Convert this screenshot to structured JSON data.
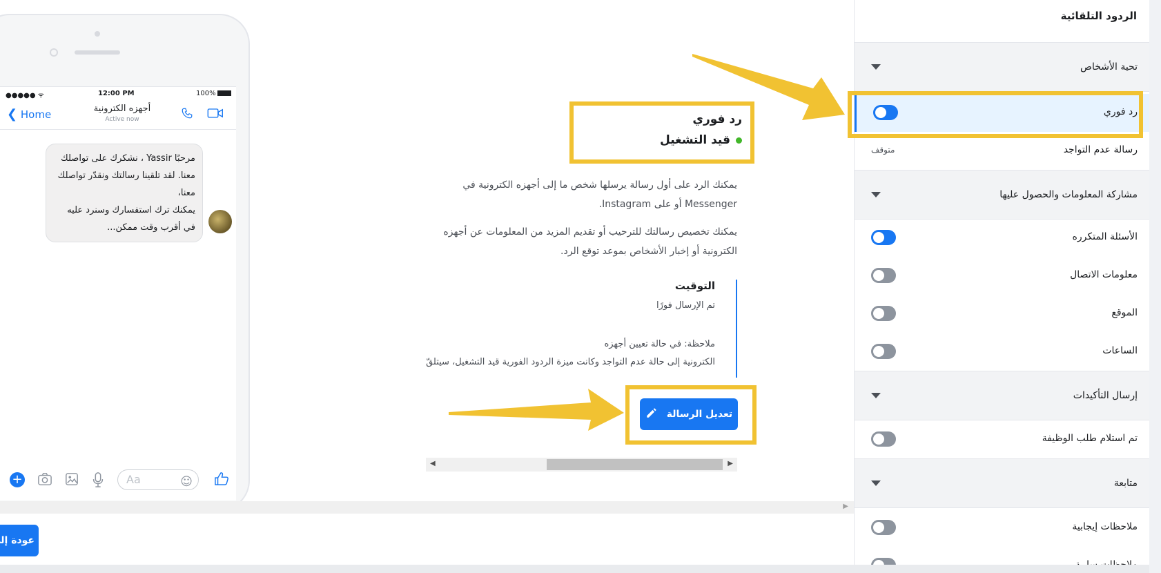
{
  "panel": {
    "title": "الردود التلقائية",
    "sections": [
      {
        "label": "تحية الأشخاص"
      },
      {
        "label": "مشاركة المعلومات والحصول عليها"
      },
      {
        "label": "إرسال التأكيدات"
      },
      {
        "label": "متابعة"
      }
    ],
    "rows": {
      "instant_reply": "رد فوري",
      "away_message": "رسالة عدم التواجد",
      "away_status": "متوقف",
      "faq": "الأسئلة المتكرره",
      "contact_info": "معلومات الاتصال",
      "location": "الموقع",
      "hours": "الساعات",
      "job_application": "تم استلام طلب الوظيفة",
      "positive_feedback": "ملاحظات إيجابية",
      "negative_feedback": "ملاحظات سلبية"
    }
  },
  "detail": {
    "title": "رد فوري",
    "status": "قيد التشغيل",
    "desc1": "يمكنك الرد على أول رسالة يرسلها شخص ما إلى أجهزه الكترونية في Messenger أو على Instagram.",
    "desc2": "يمكنك تخصيص رسالتك للترحيب أو تقديم المزيد من المعلومات عن أجهزه الكترونية أو إخبار الأشخاص بموعد توقع الرد.",
    "timing_title": "التوقيت",
    "timing_text": "تم الإرسال فورًا",
    "timing_note_line1": "ملاحظة: في حالة تعيين أجهزه",
    "timing_note_line2": "الكترونية إلى حالة عدم التواجد وكانت ميزة الردود الفورية قيد التشغيل، سيتلقّ",
    "edit_button": "تعديل الرسالة"
  },
  "phone": {
    "carrier": "●●●●● ᯤ",
    "time": "12:00 PM",
    "battery": "100%",
    "back": "Home",
    "contact_name": "أجهزه الكترونية",
    "active": "Active now",
    "message": "مرحبًا Yassir ، نشكرك على تواصلك معنا. لقد تلقينا رسالتك ونقدّر تواصلك معنا،\nيمكنك ترك استفسارك وسنرد عليه في أقرب وقت ممكن...",
    "composer_placeholder": "Aa"
  },
  "footer": {
    "back_button": "عودة إلى"
  },
  "colors": {
    "accent": "#1877f2",
    "highlight": "#f1c232",
    "online": "#42b72a"
  },
  "icons": [
    "pencil-icon",
    "chevron-left-icon",
    "phone-icon",
    "video-icon",
    "plus-icon",
    "camera-icon",
    "image-icon",
    "mic-icon",
    "emoji-icon",
    "like-icon",
    "caret-down-icon"
  ]
}
